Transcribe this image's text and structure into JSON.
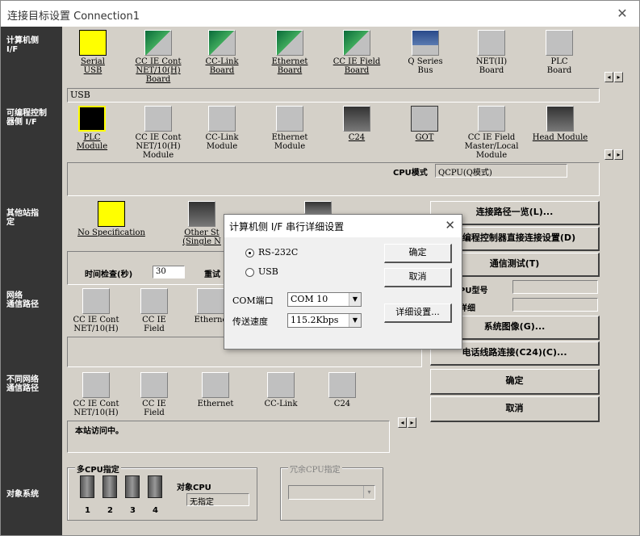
{
  "window": {
    "title": "连接目标设置 Connection1",
    "close_glyph": "✕"
  },
  "sidebar": {
    "pc_side": "计算机侧\nI/F",
    "plc_side": "可编程控制\n器侧 I/F",
    "other_station": "其他站指\n定",
    "network_route": "网络\n通信路径",
    "diff_network_route": "不同网络\n通信路径",
    "target_system": "对象系统"
  },
  "pc_if": {
    "items": [
      {
        "label": "Serial\nUSB",
        "icon": "serial-usb-icon",
        "selected": true
      },
      {
        "label": "CC IE Cont\nNET/10(H)\nBoard",
        "icon": "cc-ie-cont-board-icon"
      },
      {
        "label": "CC-Link\nBoard",
        "icon": "cc-link-board-icon"
      },
      {
        "label": "Ethernet\nBoard",
        "icon": "ethernet-board-icon"
      },
      {
        "label": "CC IE Field\nBoard",
        "icon": "cc-ie-field-board-icon"
      },
      {
        "label": "Q Series\nBus",
        "icon": "q-series-bus-icon"
      },
      {
        "label": "NET(II)\nBoard",
        "icon": "net-ii-board-icon"
      },
      {
        "label": "PLC\nBoard",
        "icon": "plc-board-icon"
      }
    ],
    "status": "USB"
  },
  "plc_if": {
    "items": [
      {
        "label": "PLC\nModule",
        "icon": "plc-module-icon",
        "selected": true
      },
      {
        "label": "CC IE Cont\nNET/10(H)\nModule",
        "icon": "cc-ie-cont-module-icon"
      },
      {
        "label": "CC-Link\nModule",
        "icon": "cc-link-module-icon"
      },
      {
        "label": "Ethernet\nModule",
        "icon": "ethernet-module-icon"
      },
      {
        "label": "C24",
        "icon": "c24-icon"
      },
      {
        "label": "GOT",
        "icon": "got-icon"
      },
      {
        "label": "CC IE Field\nMaster/Local\nModule",
        "icon": "cc-ie-field-master-icon"
      },
      {
        "label": "Head Module",
        "icon": "head-module-icon"
      }
    ],
    "cpu_mode_label": "CPU模式",
    "cpu_mode_value": "QCPU(Q模式)"
  },
  "other_station": {
    "no_spec": "No Specification",
    "other_station_single": "Other St\n(Single N",
    "time_check_label": "时间检查(秒)",
    "time_check_value": "30",
    "retry_label": "重试"
  },
  "network_route": {
    "items": [
      {
        "label": "CC IE Cont\nNET/10(H)"
      },
      {
        "label": "CC IE\nField"
      },
      {
        "label": "Etherne"
      }
    ]
  },
  "diff_network_route": {
    "items": [
      {
        "label": "CC IE Cont\nNET/10(H)"
      },
      {
        "label": "CC IE\nField"
      },
      {
        "label": "Ethernet"
      },
      {
        "label": "CC-Link"
      },
      {
        "label": "C24"
      }
    ],
    "status_text": "本站访问中。"
  },
  "right_buttons": {
    "route_list": "连接路径一览(L)...",
    "plc_direct": "可编程控制器直接连接设置(D)",
    "comm_test": "通信测试(T)",
    "cpu_type_label": "PU型号",
    "detail_label": "详细",
    "system_image": "系统图像(G)...",
    "phone_connect": "电话线路连接(C24)(C)...",
    "ok": "确定",
    "cancel": "取消"
  },
  "target_system": {
    "multi_cpu_label": "多CPU指定",
    "target_cpu_label": "对象CPU",
    "target_cpu_value": "无指定",
    "cpu_numbers": [
      "1",
      "2",
      "3",
      "4"
    ],
    "redundant_label": "冗余CPU指定"
  },
  "dialog": {
    "title": "计算机侧 I/F 串行详细设置",
    "close_glyph": "✕",
    "radio_rs232c": "RS-232C",
    "radio_usb": "USB",
    "com_port_label": "COM端口",
    "com_port_value": "COM 10",
    "baud_label": "传送速度",
    "baud_value": "115.2Kbps",
    "ok": "确定",
    "cancel": "取消",
    "detail": "详细设置..."
  }
}
